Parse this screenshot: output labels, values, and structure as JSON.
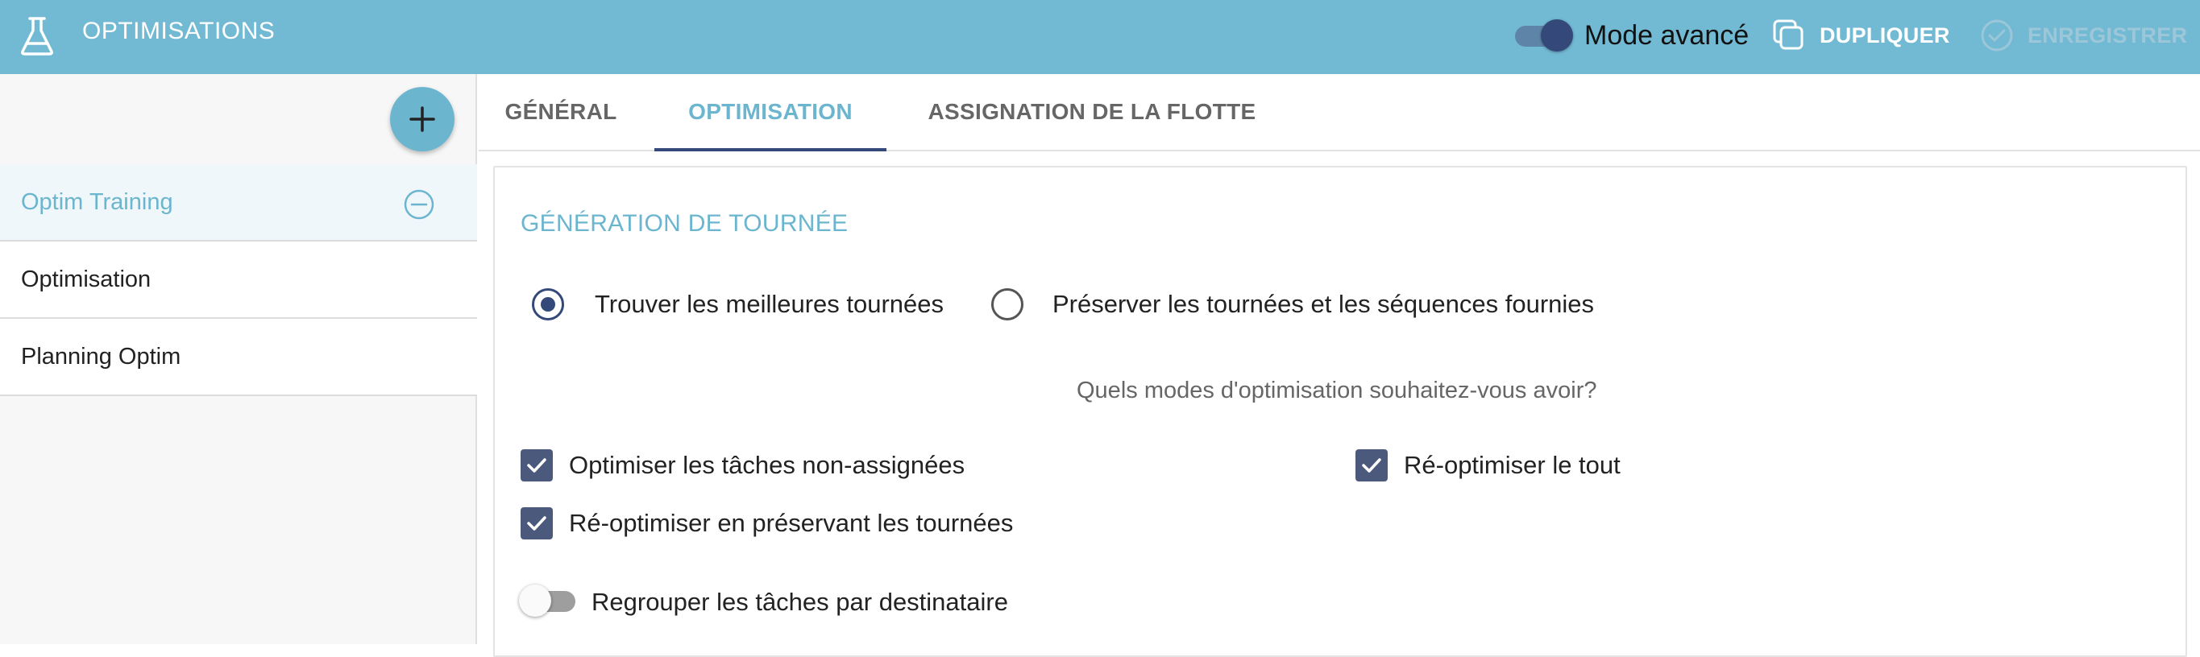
{
  "header": {
    "title": "OPTIMISATIONS",
    "app_icon": "flask-icon",
    "advanced_mode_label": "Mode avancé",
    "advanced_mode_on": true,
    "duplicate_label": "DUPLIQUER",
    "duplicate_icon": "copy-icon",
    "save_label": "ENREGISTRER",
    "save_icon": "check-circle-icon"
  },
  "sidebar": {
    "add_icon": "plus-icon",
    "items": [
      {
        "label": "Optim Training",
        "active": true,
        "remove_icon": "minus-circle-icon"
      },
      {
        "label": "Optimisation",
        "active": false
      },
      {
        "label": "Planning Optim",
        "active": false
      }
    ]
  },
  "tabs": [
    {
      "label": "GÉNÉRAL",
      "active": false
    },
    {
      "label": "OPTIMISATION",
      "active": true
    },
    {
      "label": "ASSIGNATION DE LA FLOTTE",
      "active": false
    }
  ],
  "main": {
    "section_title": "GÉNÉRATION DE TOURNÉE",
    "radio_options": [
      {
        "label": "Trouver les meilleures tournées",
        "checked": true
      },
      {
        "label": "Préserver les tournées et les séquences fournies",
        "checked": false
      }
    ],
    "question": "Quels modes d'optimisation souhaitez-vous avoir?",
    "checkboxes": [
      {
        "label": "Optimiser les tâches non-assignées",
        "checked": true
      },
      {
        "label": "Ré-optimiser le tout",
        "checked": true
      },
      {
        "label": "Ré-optimiser en préservant les tournées",
        "checked": true
      }
    ],
    "group_toggle": {
      "label": "Regrouper les tâches par destinataire",
      "on": false
    }
  },
  "colors": {
    "header_bg": "#72b9d3",
    "accent": "#6cb5cf",
    "dark_accent": "#34497a",
    "checkbox_bg": "#4b5a7c"
  }
}
